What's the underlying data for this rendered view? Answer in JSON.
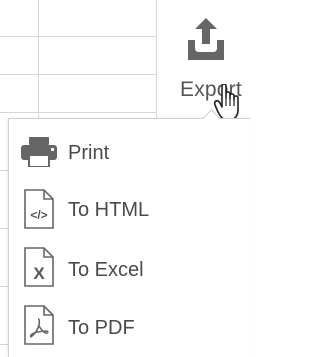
{
  "toolbar": {
    "export_label": "Export"
  },
  "export_menu": {
    "items": [
      {
        "label": "Print",
        "icon": "printer-icon"
      },
      {
        "label": "To HTML",
        "icon": "html-file-icon"
      },
      {
        "label": "To Excel",
        "icon": "excel-file-icon"
      },
      {
        "label": "To PDF",
        "icon": "pdf-file-icon"
      }
    ]
  },
  "colors": {
    "icon_gray": "#666666",
    "text": "#4a4a4a",
    "grid": "#d6d6d6"
  }
}
